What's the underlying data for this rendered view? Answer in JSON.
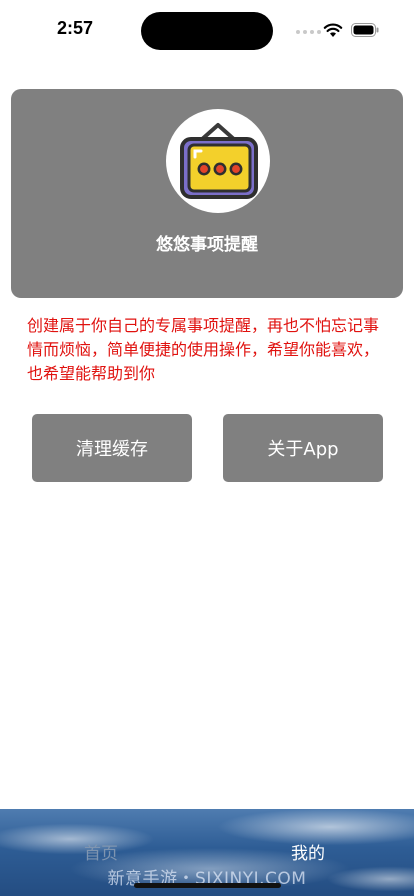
{
  "status_bar": {
    "time": "2:57"
  },
  "header": {
    "app_icon": "message-dots-icon",
    "title": "悠悠事项提醒"
  },
  "description": "创建属于你自己的专属事项提醒，再也不怕忘记事情而烦恼，简单便捷的使用操作，希望你能喜欢，也希望能帮助到你",
  "actions": {
    "clear_cache": "清理缓存",
    "about": "关于App"
  },
  "tab_bar": {
    "home": "首页",
    "mine": "我的",
    "watermark": "新意手游・SJXINYI.COM"
  },
  "colors": {
    "card_gray": "#808080",
    "description_red": "#e0120f",
    "tab_active": "#ffffff",
    "tab_inactive": "#7f95b0"
  }
}
